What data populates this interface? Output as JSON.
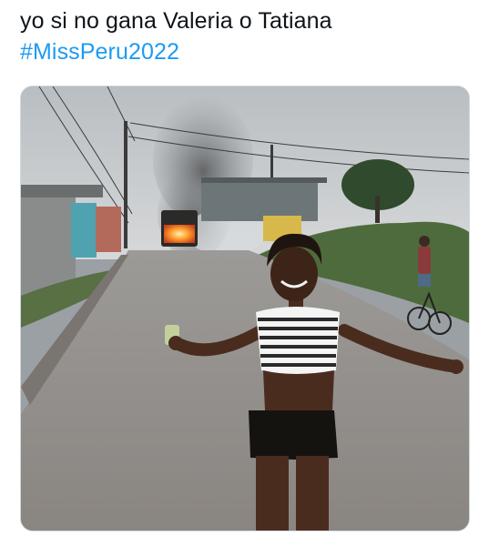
{
  "tweet": {
    "text_line": "yo si no gana Valeria o Tatiana",
    "hashtag": "#MissPeru2022"
  },
  "media": {
    "scene": "woman-smiling-on-street-with-burning-bus-icon"
  },
  "colors": {
    "text": "#0f1419",
    "hashtag": "#1d9bf0",
    "media_border": "#cfd9de"
  }
}
